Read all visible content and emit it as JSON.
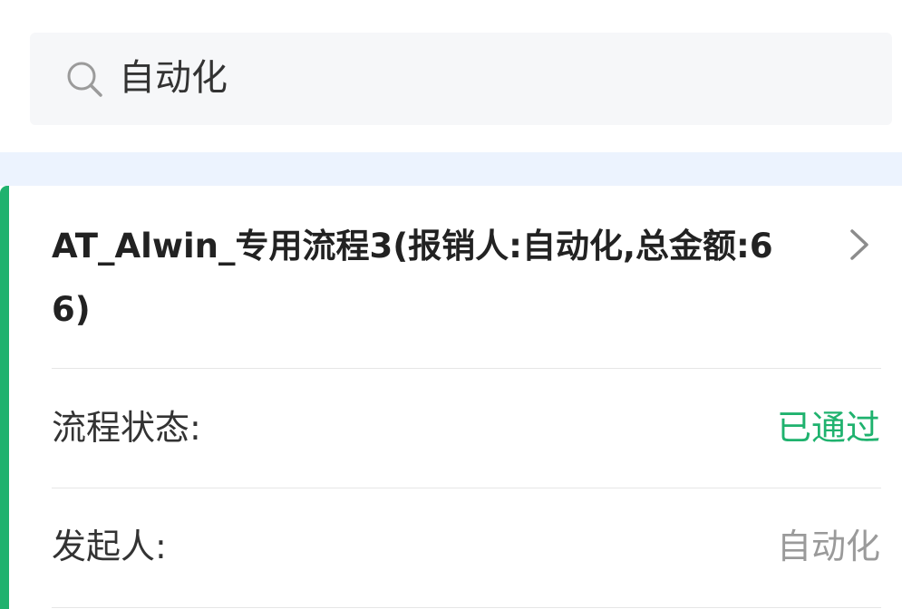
{
  "search": {
    "query": "自动化",
    "icon": "search-icon"
  },
  "card": {
    "title": "AT_Alwin_专用流程3(报销人:自动化,总金额:66)",
    "accent_color": "#1fb26e",
    "rows": [
      {
        "label": "流程状态:",
        "value": "已通过",
        "value_color": "#1fb26e"
      },
      {
        "label": "发起人:",
        "value": "自动化",
        "value_color": "#9a9a9a"
      }
    ]
  }
}
